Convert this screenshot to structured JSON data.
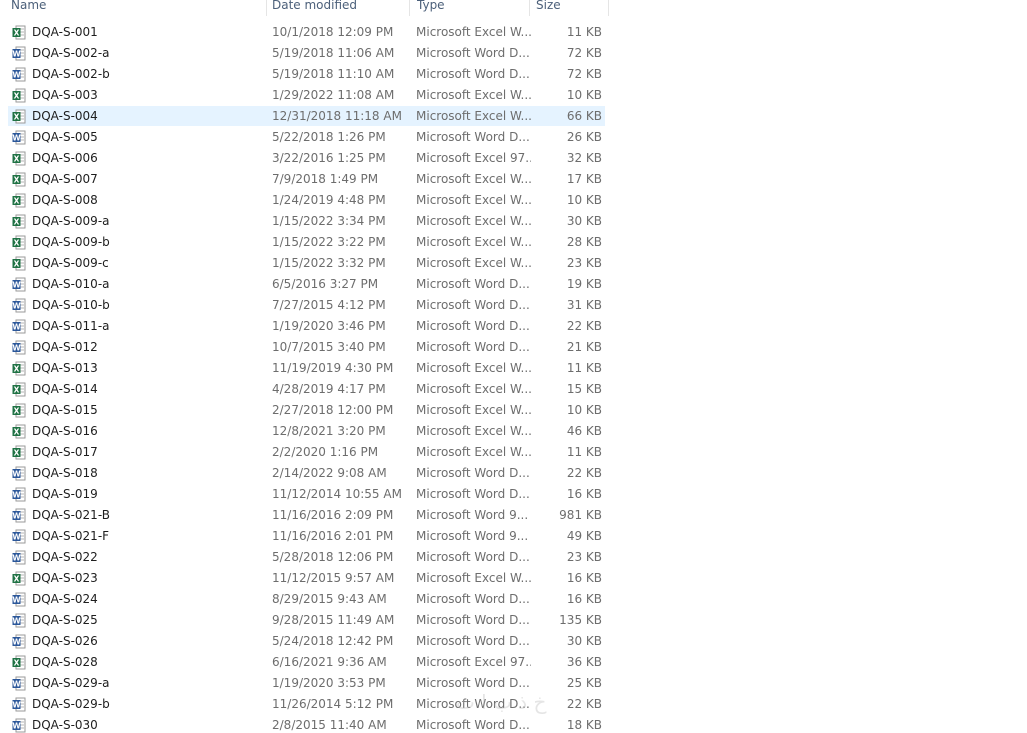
{
  "columns": {
    "name": "Name",
    "date": "Date modified",
    "type": "Type",
    "size": "Size"
  },
  "colors": {
    "excel": "#1f7244",
    "word": "#2b579a",
    "selected_row": "#e5f3ff",
    "header_text": "#4c607a"
  },
  "files": [
    {
      "name": "DQA-S-001",
      "date": "10/1/2018 12:09 PM",
      "type": "Microsoft Excel W...",
      "size": "11 KB",
      "icon": "excel"
    },
    {
      "name": "DQA-S-002-a",
      "date": "5/19/2018 11:06 AM",
      "type": "Microsoft Word D...",
      "size": "72 KB",
      "icon": "word"
    },
    {
      "name": "DQA-S-002-b",
      "date": "5/19/2018 11:10 AM",
      "type": "Microsoft Word D...",
      "size": "72 KB",
      "icon": "word"
    },
    {
      "name": "DQA-S-003",
      "date": "1/29/2022 11:08 AM",
      "type": "Microsoft Excel W...",
      "size": "10 KB",
      "icon": "excel"
    },
    {
      "name": "DQA-S-004",
      "date": "12/31/2018 11:18 AM",
      "type": "Microsoft Excel W...",
      "size": "66 KB",
      "icon": "excel",
      "selected": true
    },
    {
      "name": "DQA-S-005",
      "date": "5/22/2018 1:26 PM",
      "type": "Microsoft Word D...",
      "size": "26 KB",
      "icon": "word"
    },
    {
      "name": "DQA-S-006",
      "date": "3/22/2016 1:25 PM",
      "type": "Microsoft Excel 97...",
      "size": "32 KB",
      "icon": "excel97"
    },
    {
      "name": "DQA-S-007",
      "date": "7/9/2018 1:49 PM",
      "type": "Microsoft Excel W...",
      "size": "17 KB",
      "icon": "excel"
    },
    {
      "name": "DQA-S-008",
      "date": "1/24/2019 4:48 PM",
      "type": "Microsoft Excel W...",
      "size": "10 KB",
      "icon": "excel"
    },
    {
      "name": "DQA-S-009-a",
      "date": "1/15/2022 3:34 PM",
      "type": "Microsoft Excel W...",
      "size": "30 KB",
      "icon": "excel"
    },
    {
      "name": "DQA-S-009-b",
      "date": "1/15/2022 3:22 PM",
      "type": "Microsoft Excel W...",
      "size": "28 KB",
      "icon": "excel"
    },
    {
      "name": "DQA-S-009-c",
      "date": "1/15/2022 3:32 PM",
      "type": "Microsoft Excel W...",
      "size": "23 KB",
      "icon": "excel"
    },
    {
      "name": "DQA-S-010-a",
      "date": "6/5/2016 3:27 PM",
      "type": "Microsoft Word D...",
      "size": "19 KB",
      "icon": "word"
    },
    {
      "name": "DQA-S-010-b",
      "date": "7/27/2015 4:12 PM",
      "type": "Microsoft Word D...",
      "size": "31 KB",
      "icon": "word"
    },
    {
      "name": "DQA-S-011-a",
      "date": "1/19/2020 3:46 PM",
      "type": "Microsoft Word D...",
      "size": "22 KB",
      "icon": "word"
    },
    {
      "name": "DQA-S-012",
      "date": "10/7/2015 3:40 PM",
      "type": "Microsoft Word D...",
      "size": "21 KB",
      "icon": "word"
    },
    {
      "name": "DQA-S-013",
      "date": "11/19/2019 4:30 PM",
      "type": "Microsoft Excel W...",
      "size": "11 KB",
      "icon": "excel"
    },
    {
      "name": "DQA-S-014",
      "date": "4/28/2019 4:17 PM",
      "type": "Microsoft Excel W...",
      "size": "15 KB",
      "icon": "excel"
    },
    {
      "name": "DQA-S-015",
      "date": "2/27/2018 12:00 PM",
      "type": "Microsoft Excel W...",
      "size": "10 KB",
      "icon": "excel"
    },
    {
      "name": "DQA-S-016",
      "date": "12/8/2021 3:20 PM",
      "type": "Microsoft Excel W...",
      "size": "46 KB",
      "icon": "excel"
    },
    {
      "name": "DQA-S-017",
      "date": "2/2/2020 1:16 PM",
      "type": "Microsoft Excel W...",
      "size": "11 KB",
      "icon": "excel"
    },
    {
      "name": "DQA-S-018",
      "date": "2/14/2022 9:08 AM",
      "type": "Microsoft Word D...",
      "size": "22 KB",
      "icon": "word"
    },
    {
      "name": "DQA-S-019",
      "date": "11/12/2014 10:55 AM",
      "type": "Microsoft Word D...",
      "size": "16 KB",
      "icon": "word"
    },
    {
      "name": "DQA-S-021-B",
      "date": "11/16/2016 2:09 PM",
      "type": "Microsoft Word 9...",
      "size": "981 KB",
      "icon": "word97"
    },
    {
      "name": "DQA-S-021-F",
      "date": "11/16/2016 2:01 PM",
      "type": "Microsoft Word 9...",
      "size": "49 KB",
      "icon": "word97"
    },
    {
      "name": "DQA-S-022",
      "date": "5/28/2018 12:06 PM",
      "type": "Microsoft Word D...",
      "size": "23 KB",
      "icon": "word"
    },
    {
      "name": "DQA-S-023",
      "date": "11/12/2015 9:57 AM",
      "type": "Microsoft Excel W...",
      "size": "16 KB",
      "icon": "excel"
    },
    {
      "name": "DQA-S-024",
      "date": "8/29/2015 9:43 AM",
      "type": "Microsoft Word D...",
      "size": "16 KB",
      "icon": "word"
    },
    {
      "name": "DQA-S-025",
      "date": "9/28/2015 11:49 AM",
      "type": "Microsoft Word D...",
      "size": "135 KB",
      "icon": "word"
    },
    {
      "name": "DQA-S-026",
      "date": "5/24/2018 12:42 PM",
      "type": "Microsoft Word D...",
      "size": "30 KB",
      "icon": "word"
    },
    {
      "name": "DQA-S-028",
      "date": "6/16/2021 9:36 AM",
      "type": "Microsoft Excel 97...",
      "size": "36 KB",
      "icon": "excel97"
    },
    {
      "name": "DQA-S-029-a",
      "date": "1/19/2020 3:53 PM",
      "type": "Microsoft Word D...",
      "size": "25 KB",
      "icon": "word"
    },
    {
      "name": "DQA-S-029-b",
      "date": "11/26/2014 5:12 PM",
      "type": "Microsoft Word D...",
      "size": "22 KB",
      "icon": "word"
    },
    {
      "name": "DQA-S-030",
      "date": "2/8/2015 11:40 AM",
      "type": "Microsoft Word D...",
      "size": "18 KB",
      "icon": "word"
    }
  ]
}
